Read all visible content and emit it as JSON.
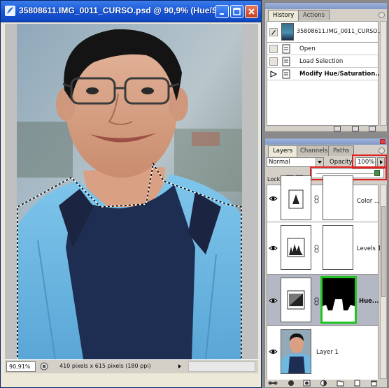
{
  "document": {
    "title": "35808611.IMG_0011_CURSO.psd @ 90,9% (Hue/S...",
    "zoom": "90,91%",
    "info": "410 pixels x 615 pixels (180 ppi)"
  },
  "history": {
    "tabs": [
      "History",
      "Actions"
    ],
    "active_tab": "History",
    "snapshot_label": "35808611.IMG_0011_CURSO...",
    "steps": [
      "Open",
      "Load Selection",
      "Modify Hue/Saturation..."
    ],
    "current_step": "Modify Hue/Saturation..."
  },
  "layers": {
    "tabs": [
      "Layers",
      "Channels",
      "Paths"
    ],
    "active_tab": "Layers",
    "blend_mode": "Normal",
    "opacity_label": "Opacity:",
    "opacity_value": "100%",
    "opacity_fraction": 1.0,
    "lock_label": "Lock:",
    "items": [
      {
        "name": "Color ...",
        "type": "adjustment"
      },
      {
        "name": "Levels 1",
        "type": "adjustment"
      },
      {
        "name": "Hue...",
        "type": "adjustment",
        "selected": true
      },
      {
        "name": "Layer 1",
        "type": "pixel"
      }
    ]
  },
  "colors": {
    "titlebar": "#1453d3",
    "highlight": "#e02020",
    "mask_selected": "#22c422"
  }
}
